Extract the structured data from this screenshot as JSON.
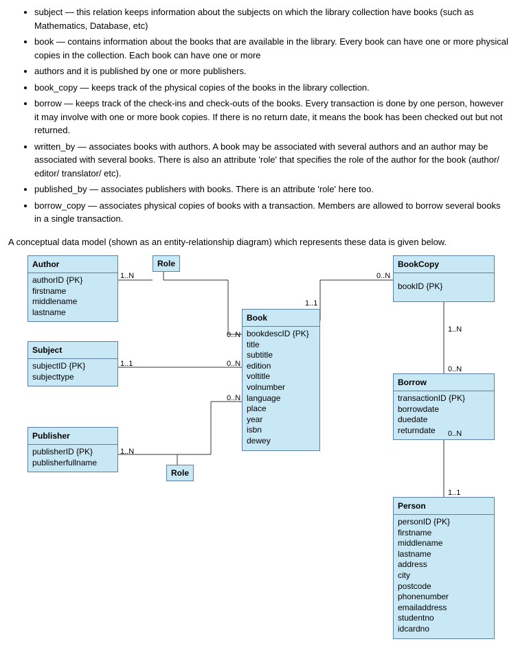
{
  "bullets": [
    {
      "term": "subject",
      "text": " — this relation keeps information about the subjects on which the library collection have books (such as Mathematics, Database, etc)"
    },
    {
      "term": "book",
      "text": " — contains information about the books that are available in the library. Every book can have one or more physical copies in the collection. Each book can have one or more"
    },
    {
      "term": "",
      "text": "authors and it is published by one or more publishers."
    },
    {
      "term": "book_copy",
      "text": " — keeps track of the physical copies of the books in the library collection."
    },
    {
      "term": "borrow",
      "text": " — keeps track of the check-ins and check-outs of the books. Every transaction is done by one person, however it may involve with one or more book copies. If there is no return date, it means the book has been checked out but not returned."
    },
    {
      "term": "written_by",
      "text": " — associates books with authors. A book may be associated with several authors and an author may be associated with several books. There is also an attribute 'role' that specifies the role of the author for the book (author/ editor/ translator/ etc)."
    },
    {
      "term": "published_by",
      "text": " — associates publishers with books. There is an attribute 'role' here too."
    },
    {
      "term": "borrow_copy",
      "text": " — associates physical copies of books with a transaction. Members are allowed to borrow several books in a single transaction."
    }
  ],
  "intro": "A conceptual data model (shown as an entity-relationship diagram) which represents these data is given below.",
  "entities": {
    "author": {
      "title": "Author",
      "attrs": [
        "authorID {PK}",
        "firstname",
        "middlename",
        "lastname"
      ]
    },
    "subject": {
      "title": "Subject",
      "attrs": [
        "subjectID {PK}",
        "subjecttype"
      ]
    },
    "publisher": {
      "title": "Publisher",
      "attrs": [
        "publisherID {PK}",
        "publisherfullname"
      ]
    },
    "book": {
      "title": "Book",
      "attrs": [
        "bookdescID {PK}",
        "title",
        "subtitle",
        "edition",
        "voltitle",
        "volnumber",
        "language",
        "place",
        "year",
        "isbn",
        "dewey"
      ]
    },
    "bookcopy": {
      "title": "BookCopy",
      "attrs": [
        "bookID {PK}"
      ]
    },
    "borrow": {
      "title": "Borrow",
      "attrs": [
        "transactionID {PK}",
        "borrowdate",
        "duedate",
        "returndate"
      ]
    },
    "person": {
      "title": "Person",
      "attrs": [
        "personID {PK}",
        "firstname",
        "middlename",
        "lastname",
        "address",
        "city",
        "postcode",
        "phonenumber",
        "emailaddress",
        "studentno",
        "idcardno"
      ]
    },
    "role1": {
      "title": "Role"
    },
    "role2": {
      "title": "Role"
    }
  },
  "cards": {
    "c1": "1..N",
    "c2": "1..1",
    "c3": "0..N",
    "c4": "0..N",
    "c5": "0..N",
    "c6": "1..1",
    "c7": "1..N",
    "c8": "0..N",
    "c9": "1..N",
    "c10": "0..N",
    "c11": "0..N",
    "c12": "1..1"
  }
}
